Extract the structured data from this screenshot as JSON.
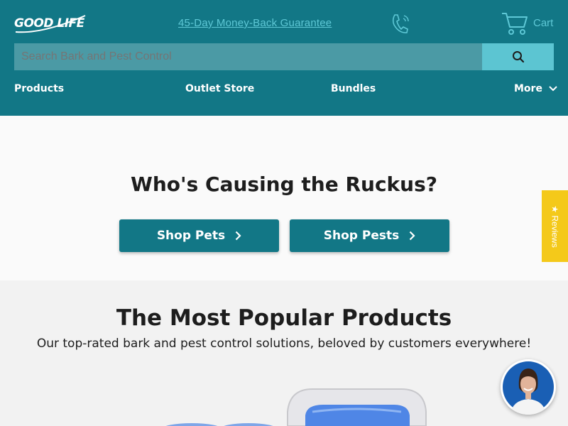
{
  "header": {
    "logo": {
      "text": "GOOD LIFE"
    },
    "guarantee": "45-Day Money-Back Guarantee",
    "phone_icon": "phone-icon",
    "cart": {
      "icon": "cart-icon",
      "label": "Cart"
    },
    "search": {
      "placeholder": "Search Bark and Pest Control",
      "button_icon": "search-icon"
    },
    "nav": [
      {
        "label": "Products"
      },
      {
        "label": "Outlet Store"
      },
      {
        "label": "Bundles"
      },
      {
        "label": "More",
        "icon": "chevron-down-icon"
      }
    ]
  },
  "hero": {
    "title": "Who's Causing the Ruckus?",
    "buttons": [
      {
        "label": "Shop Pets",
        "icon": "chevron-right-icon"
      },
      {
        "label": "Shop Pests",
        "icon": "chevron-right-icon"
      }
    ]
  },
  "reviews_tab": {
    "label": "★ Reviews"
  },
  "popular": {
    "title": "The Most Popular Products",
    "subtitle": "Our top-rated bark and pest control solutions, beloved by customers everywhere!"
  },
  "chat": {
    "icon": "support-agent-avatar"
  },
  "colors": {
    "header_bg": "#127786",
    "accent_light": "#5ec8d6",
    "search_bg": "#4b9aa5",
    "search_button": "#5cc5d2",
    "reviews_tab": "#f4c91a"
  }
}
